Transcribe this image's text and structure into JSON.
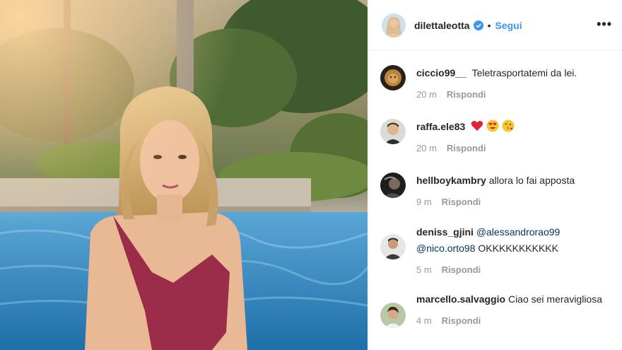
{
  "post": {
    "username": "dilettaleotta",
    "follow_label": "Segui",
    "more_label": "•••",
    "separator": "•"
  },
  "comments": [
    {
      "user": "ciccio99__",
      "text": "Teletrasportatemi da lei.",
      "time": "20 m",
      "reply": "Rispondi"
    },
    {
      "user": "raffa.ele83",
      "text": "",
      "time": "20 m",
      "reply": "Rispondi"
    },
    {
      "user": "hellboykambry",
      "text": "allora lo fai apposta",
      "time": "9 m",
      "reply": "Rispondi"
    },
    {
      "user": "deniss_gjini",
      "mention1": "@alessandrorao99",
      "mention2": "@nico.orto98",
      "text": "OKKKKKKKKKKK",
      "time": "5 m",
      "reply": "Rispondi"
    },
    {
      "user": "marcello.salvaggio",
      "text": "Ciao sei meravigliosa",
      "time": "4 m",
      "reply": "Rispondi"
    }
  ],
  "icons": {
    "verified": "verified-badge-icon",
    "emojis": [
      "red-heart-icon",
      "heart-eyes-icon",
      "face-blowing-kiss-icon"
    ]
  },
  "colors": {
    "link": "#3897f0",
    "muted": "#999999",
    "text": "#262626",
    "border": "#efefef"
  }
}
